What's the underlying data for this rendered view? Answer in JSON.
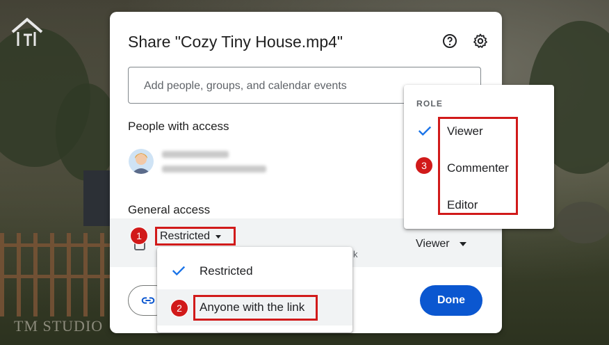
{
  "dialog": {
    "title": "Share \"Cozy Tiny House.mp4\"",
    "help_icon": "help-icon",
    "settings_icon": "gear-icon",
    "add_placeholder": "Add people, groups, and calendar events",
    "people_heading": "People with access",
    "general_heading": "General access",
    "general_access_value": "Restricted",
    "role_value": "Viewer",
    "truncated_desc": "k",
    "copy_link_icon": "link-icon",
    "done_label": "Done"
  },
  "access_menu": {
    "items": [
      {
        "label": "Restricted",
        "selected": true
      },
      {
        "label": "Anyone with the link",
        "selected": false
      }
    ]
  },
  "role_menu": {
    "heading": "ROLE",
    "items": [
      {
        "label": "Viewer",
        "selected": true
      },
      {
        "label": "Commenter",
        "selected": false
      },
      {
        "label": "Editor",
        "selected": false
      }
    ]
  },
  "annotations": {
    "step1": "1",
    "step2": "2",
    "step3": "3",
    "color": "#d11a1a"
  },
  "watermark": "TM STUDIO",
  "colors": {
    "accent": "#0b57d0",
    "check": "#1a73e8"
  }
}
